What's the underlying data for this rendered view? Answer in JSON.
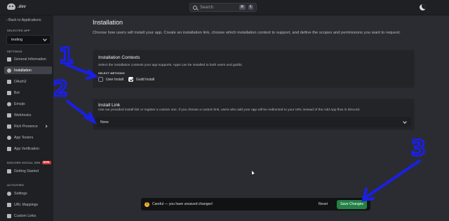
{
  "topbar": {
    "logo_text": ".dev",
    "search_placeholder": "Search",
    "kbd_1": "⌘",
    "kbd_2": "K"
  },
  "sidebar": {
    "back_label": "Back to Applications",
    "selected_app_label": "SELECTED APP",
    "selected_app": "testing",
    "settings_label": "SETTINGS",
    "settings_items": [
      {
        "label": "General Information",
        "icon": "home-icon"
      },
      {
        "label": "Installation",
        "icon": "gear-icon"
      },
      {
        "label": "OAuth2",
        "icon": "wrench-icon"
      },
      {
        "label": "Bot",
        "icon": "puzzle-icon"
      },
      {
        "label": "Emojis",
        "icon": "smiley-icon"
      },
      {
        "label": "Webhooks",
        "icon": "webhook-icon"
      },
      {
        "label": "Rich Presence",
        "icon": "document-icon"
      },
      {
        "label": "App Testers",
        "icon": "person-icon"
      },
      {
        "label": "App Verification",
        "icon": "check-icon"
      }
    ],
    "social_sdk_label": "DISCORD SOCIAL SDK",
    "new_badge": "NEW",
    "social_items": [
      {
        "label": "Getting Started",
        "icon": "rocket-icon"
      }
    ],
    "activities_label": "ACTIVITIES",
    "activity_items": [
      {
        "label": "Settings",
        "icon": "gear-icon"
      },
      {
        "label": "URL Mappings",
        "icon": "link-icon"
      },
      {
        "label": "Custom Links",
        "icon": "link-icon"
      }
    ]
  },
  "main": {
    "title": "Installation",
    "description": "Choose how users will install your app. Create an installation link, choose which installation context to support, and define the scopes and permissions you want to request.",
    "contexts": {
      "title": "Installation Contexts",
      "description": "Select the installation contexts your app supports. Apps can be installed to both users and guilds.",
      "methods_label": "SELECT METHODS",
      "options": [
        {
          "label": "User Install",
          "checked": false
        },
        {
          "label": "Guild Install",
          "checked": true
        }
      ]
    },
    "install_link": {
      "title": "Install Link",
      "description": "Use our provided install link or register a custom one. If you choose a custom link, users who add your app will be redirected to your URL instead of the Add App flow in Discord.",
      "selected": "None"
    }
  },
  "toast": {
    "message": "Careful — you have unsaved changes!",
    "reset_label": "Reset",
    "save_label": "Save Changes"
  },
  "annotations": {
    "labels": [
      "1",
      "2",
      "3"
    ],
    "color": "#1a1fe6"
  },
  "colors": {
    "accent_green": "#248046",
    "warning": "#f0b232",
    "new_badge": "#da373c"
  }
}
